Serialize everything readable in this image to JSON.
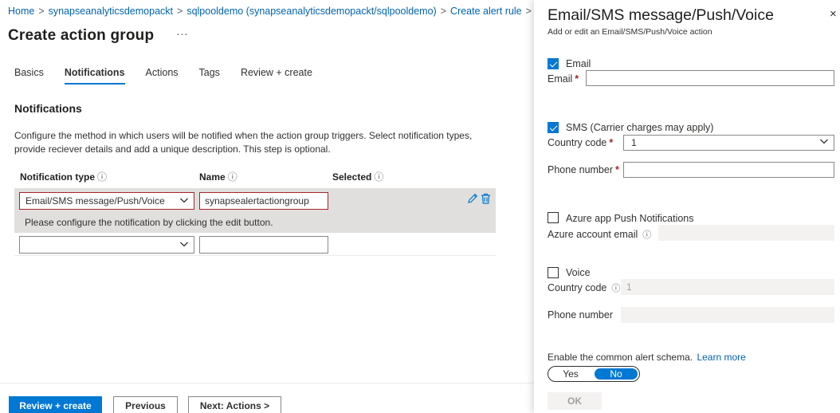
{
  "breadcrumb": {
    "items": [
      "Home",
      "synapseanalyticsdemopackt",
      "sqlpooldemo (synapseanalyticsdemopackt/sqlpooldemo)",
      "Create alert rule"
    ],
    "separator": ">"
  },
  "page": {
    "title": "Create action group",
    "more": "···"
  },
  "tabs": [
    "Basics",
    "Notifications",
    "Actions",
    "Tags",
    "Review + create"
  ],
  "active_tab": "Notifications",
  "notifications": {
    "title": "Notifications",
    "description": "Configure the method in which users will be notified when the action group triggers. Select notification types, provide reciever details and add a unique description. This step is optional.",
    "columns": {
      "type": "Notification type",
      "name": "Name",
      "selected": "Selected",
      "info": "ⓘ"
    },
    "rows": [
      {
        "type": "Email/SMS message/Push/Voice",
        "name": "synapsealertactiongroup",
        "message": "Please configure the notification by clicking the edit button."
      },
      {
        "type": "",
        "name": ""
      }
    ]
  },
  "footer": {
    "review": "Review + create",
    "previous": "Previous",
    "next": "Next: Actions >"
  },
  "panel": {
    "title": "Email/SMS message/Push/Voice",
    "subtitle": "Add or edit an Email/SMS/Push/Voice action",
    "close": "×",
    "email": {
      "checkbox_label": "Email",
      "checked": true,
      "field_label": "Email",
      "required": "*",
      "value": ""
    },
    "sms": {
      "checkbox_label": "SMS (Carrier charges may apply)",
      "checked": true,
      "country_label": "Country code",
      "country_value": "1",
      "phone_label": "Phone number",
      "phone_value": "",
      "required": "*"
    },
    "push": {
      "checkbox_label": "Azure app Push Notifications",
      "checked": false,
      "field_label": "Azure account email",
      "info": "ⓘ",
      "value": ""
    },
    "voice": {
      "checkbox_label": "Voice",
      "checked": false,
      "country_label": "Country code",
      "info": "ⓘ",
      "country_value": "1",
      "phone_label": "Phone number",
      "phone_value": ""
    },
    "schema": {
      "label": "Enable the common alert schema.",
      "link": "Learn more",
      "yes": "Yes",
      "no": "No",
      "selected": "No"
    },
    "ok": "OK"
  },
  "colors": {
    "accent": "#0078d4",
    "link": "#0063b1",
    "error": "#a4262c",
    "row_highlight": "#e1dfdd"
  }
}
